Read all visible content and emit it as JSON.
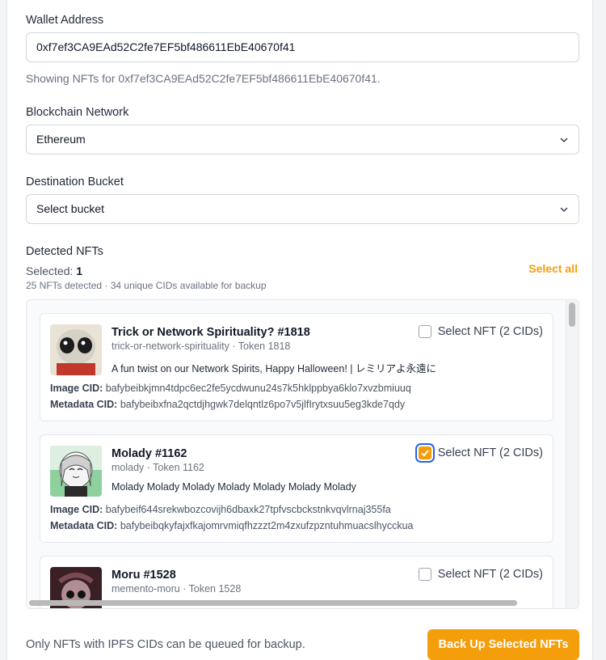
{
  "wallet": {
    "label": "Wallet Address",
    "value": "0xf7ef3CA9EAd52C2fe7EF5bf486611EbE40670f41",
    "helper": "Showing NFTs for 0xf7ef3CA9EAd52C2fe7EF5bf486611EbE40670f41."
  },
  "network": {
    "label": "Blockchain Network",
    "selected": "Ethereum"
  },
  "bucket": {
    "label": "Destination Bucket",
    "selected": "Select bucket"
  },
  "detected": {
    "label": "Detected NFTs",
    "selected_prefix": "Selected:",
    "selected_count": "1",
    "summary": "25 NFTs detected · 34 unique CIDs available for backup",
    "select_all": "Select all"
  },
  "nfts": [
    {
      "title": "Trick or Network Spirituality? #1818",
      "sub": "trick-or-network-spirituality · Token 1818",
      "desc": "A fun twist on our Network Spirits, Happy Halloween! | レミリアよ永遠に",
      "image_cid_label": "Image CID:",
      "image_cid": "bafybeibkjmn4tdpc6ec2fe5ycdwunu24s7k5hklppbya6klo7xvzbmiuuq",
      "metadata_cid_label": "Metadata CID:",
      "metadata_cid": "bafybeibxfna2qctdjhgwk7delqntlz6po7v5jlfIrytxsuu5eg3kde7qdy",
      "select_label": "Select NFT (2 CIDs)",
      "checked": false
    },
    {
      "title": "Molady #1162",
      "sub": "molady · Token 1162",
      "desc": "Molady Molady Molady Molady Molady Molady Molady",
      "image_cid_label": "Image CID:",
      "image_cid": "bafybeif644srekwbozcovijh6dbaxk27tpfvscbckstnkvqvlrnaj355fa",
      "metadata_cid_label": "Metadata CID:",
      "metadata_cid": "bafybeibqkyfajxfkajomrvmiqfhzzzt2m4zxufzpzntuhmuacslhycckua",
      "select_label": "Select NFT (2 CIDs)",
      "checked": true
    },
    {
      "title": "Moru #1528",
      "sub": "memento-moru · Token 1528",
      "select_label": "Select NFT (2 CIDs)",
      "checked": false
    }
  ],
  "footer": {
    "note": "Only NFTs with IPFS CIDs can be queued for backup.",
    "cta": "Back Up Selected NFTs"
  },
  "colors": {
    "accent": "#f59e0b",
    "focus_ring": "#2563eb"
  }
}
